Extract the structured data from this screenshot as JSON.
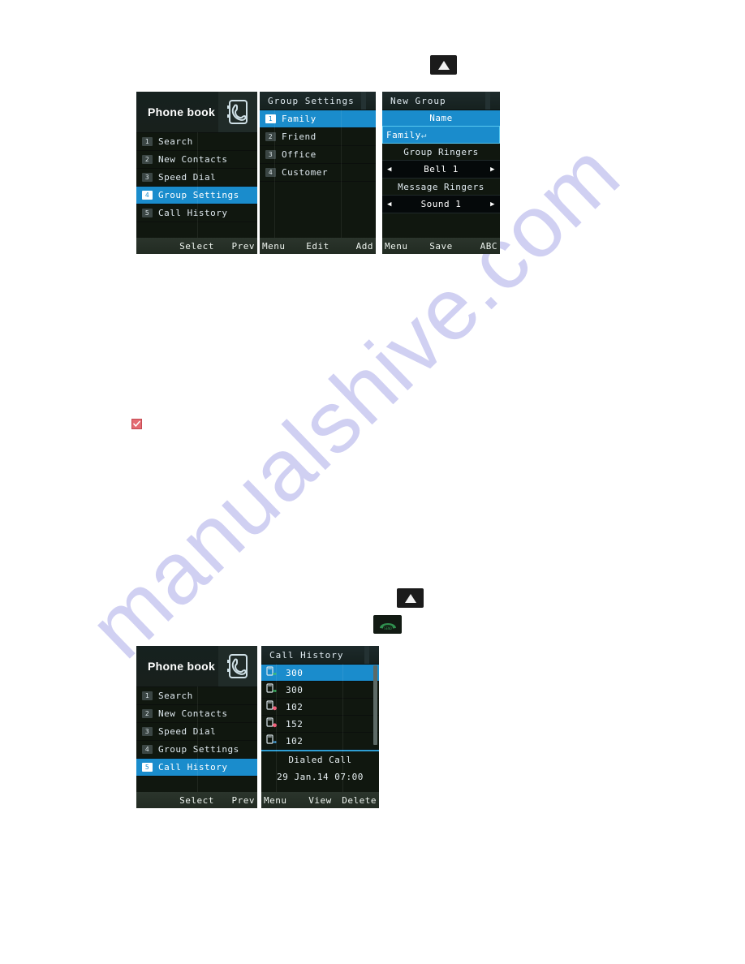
{
  "page": {
    "watermark": "manualshive.com"
  },
  "icons": {
    "up_key": "up-triangle-key",
    "send_key": "green-send-call-key",
    "note_marker": "red-check-marker",
    "phonebook_header": "phonebook-icon"
  },
  "figure_top": {
    "up_key_label": "▲",
    "phonebook_screen": {
      "header_title": "Phone book",
      "items": [
        {
          "num": "1",
          "label": "Search"
        },
        {
          "num": "2",
          "label": "New Contacts"
        },
        {
          "num": "3",
          "label": "Speed Dial"
        },
        {
          "num": "4",
          "label": "Group Settings"
        },
        {
          "num": "5",
          "label": "Call History"
        }
      ],
      "selected_index": 3,
      "softkeys": {
        "left": "",
        "center": "Select",
        "right": "Prev"
      }
    },
    "group_settings_screen": {
      "title": "Group Settings",
      "items": [
        {
          "num": "1",
          "label": "Family"
        },
        {
          "num": "2",
          "label": "Friend"
        },
        {
          "num": "3",
          "label": "Office"
        },
        {
          "num": "4",
          "label": "Customer"
        }
      ],
      "selected_index": 0,
      "softkeys": {
        "left": "Menu",
        "center": "Edit",
        "right": "Add"
      }
    },
    "new_group_screen": {
      "title": "New Group",
      "name_label": "Name",
      "name_value": "Family",
      "group_ringers_label": "Group Ringers",
      "group_ringers_value": "Bell 1",
      "message_ringers_label": "Message Ringers",
      "message_ringers_value": "Sound 1",
      "arrow_left": "◀",
      "arrow_right": "▶",
      "softkeys": {
        "left": "Menu",
        "center": "Save",
        "right": "ABC"
      }
    }
  },
  "figure_bottom": {
    "up_key_label": "▲",
    "phonebook_screen": {
      "header_title": "Phone book",
      "items": [
        {
          "num": "1",
          "label": "Search"
        },
        {
          "num": "2",
          "label": "New Contacts"
        },
        {
          "num": "3",
          "label": "Speed Dial"
        },
        {
          "num": "4",
          "label": "Group Settings"
        },
        {
          "num": "5",
          "label": "Call History"
        }
      ],
      "selected_index": 4,
      "softkeys": {
        "left": "",
        "center": "Select",
        "right": "Prev"
      }
    },
    "call_history_screen": {
      "title": "Call History",
      "entries": [
        {
          "number": "300",
          "type": "dialed"
        },
        {
          "number": "300",
          "type": "dialed"
        },
        {
          "number": "102",
          "type": "missed"
        },
        {
          "number": "152",
          "type": "missed"
        },
        {
          "number": "102",
          "type": "dialed"
        }
      ],
      "selected_index": 0,
      "detail_type": "Dialed Call",
      "detail_time": "29 Jan.14 07:00",
      "softkeys": {
        "left": "Menu",
        "center": "View",
        "right": "Delete"
      }
    }
  }
}
